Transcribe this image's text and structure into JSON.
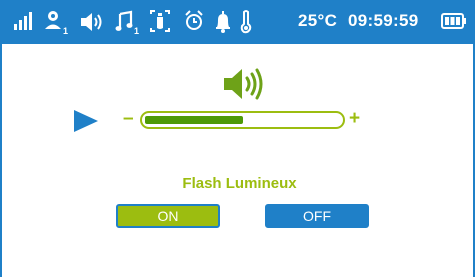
{
  "status_bar": {
    "icons": [
      {
        "name": "signal-icon"
      },
      {
        "name": "user-icon",
        "sub": "1"
      },
      {
        "name": "volume-icon"
      },
      {
        "name": "music-icon",
        "sub": "1"
      },
      {
        "name": "feeding-icon"
      },
      {
        "name": "alarm-icon"
      },
      {
        "name": "bell-icon"
      },
      {
        "name": "thermometer-icon"
      }
    ],
    "temperature": "25°C",
    "time": "09:59:59",
    "battery_icon": "battery-icon"
  },
  "main": {
    "speaker_icon": "speaker-icon",
    "play_icon": "play-icon",
    "volume": {
      "minus_label": "–",
      "plus_label": "+",
      "level_fraction": 0.5
    },
    "flash": {
      "title": "Flash Lumineux",
      "on_label": "ON",
      "off_label": "OFF",
      "selected": "ON"
    }
  },
  "colors": {
    "accent_blue": "#1f80c8",
    "accent_green": "#9cbd10",
    "fill_green": "#4e9a06"
  }
}
